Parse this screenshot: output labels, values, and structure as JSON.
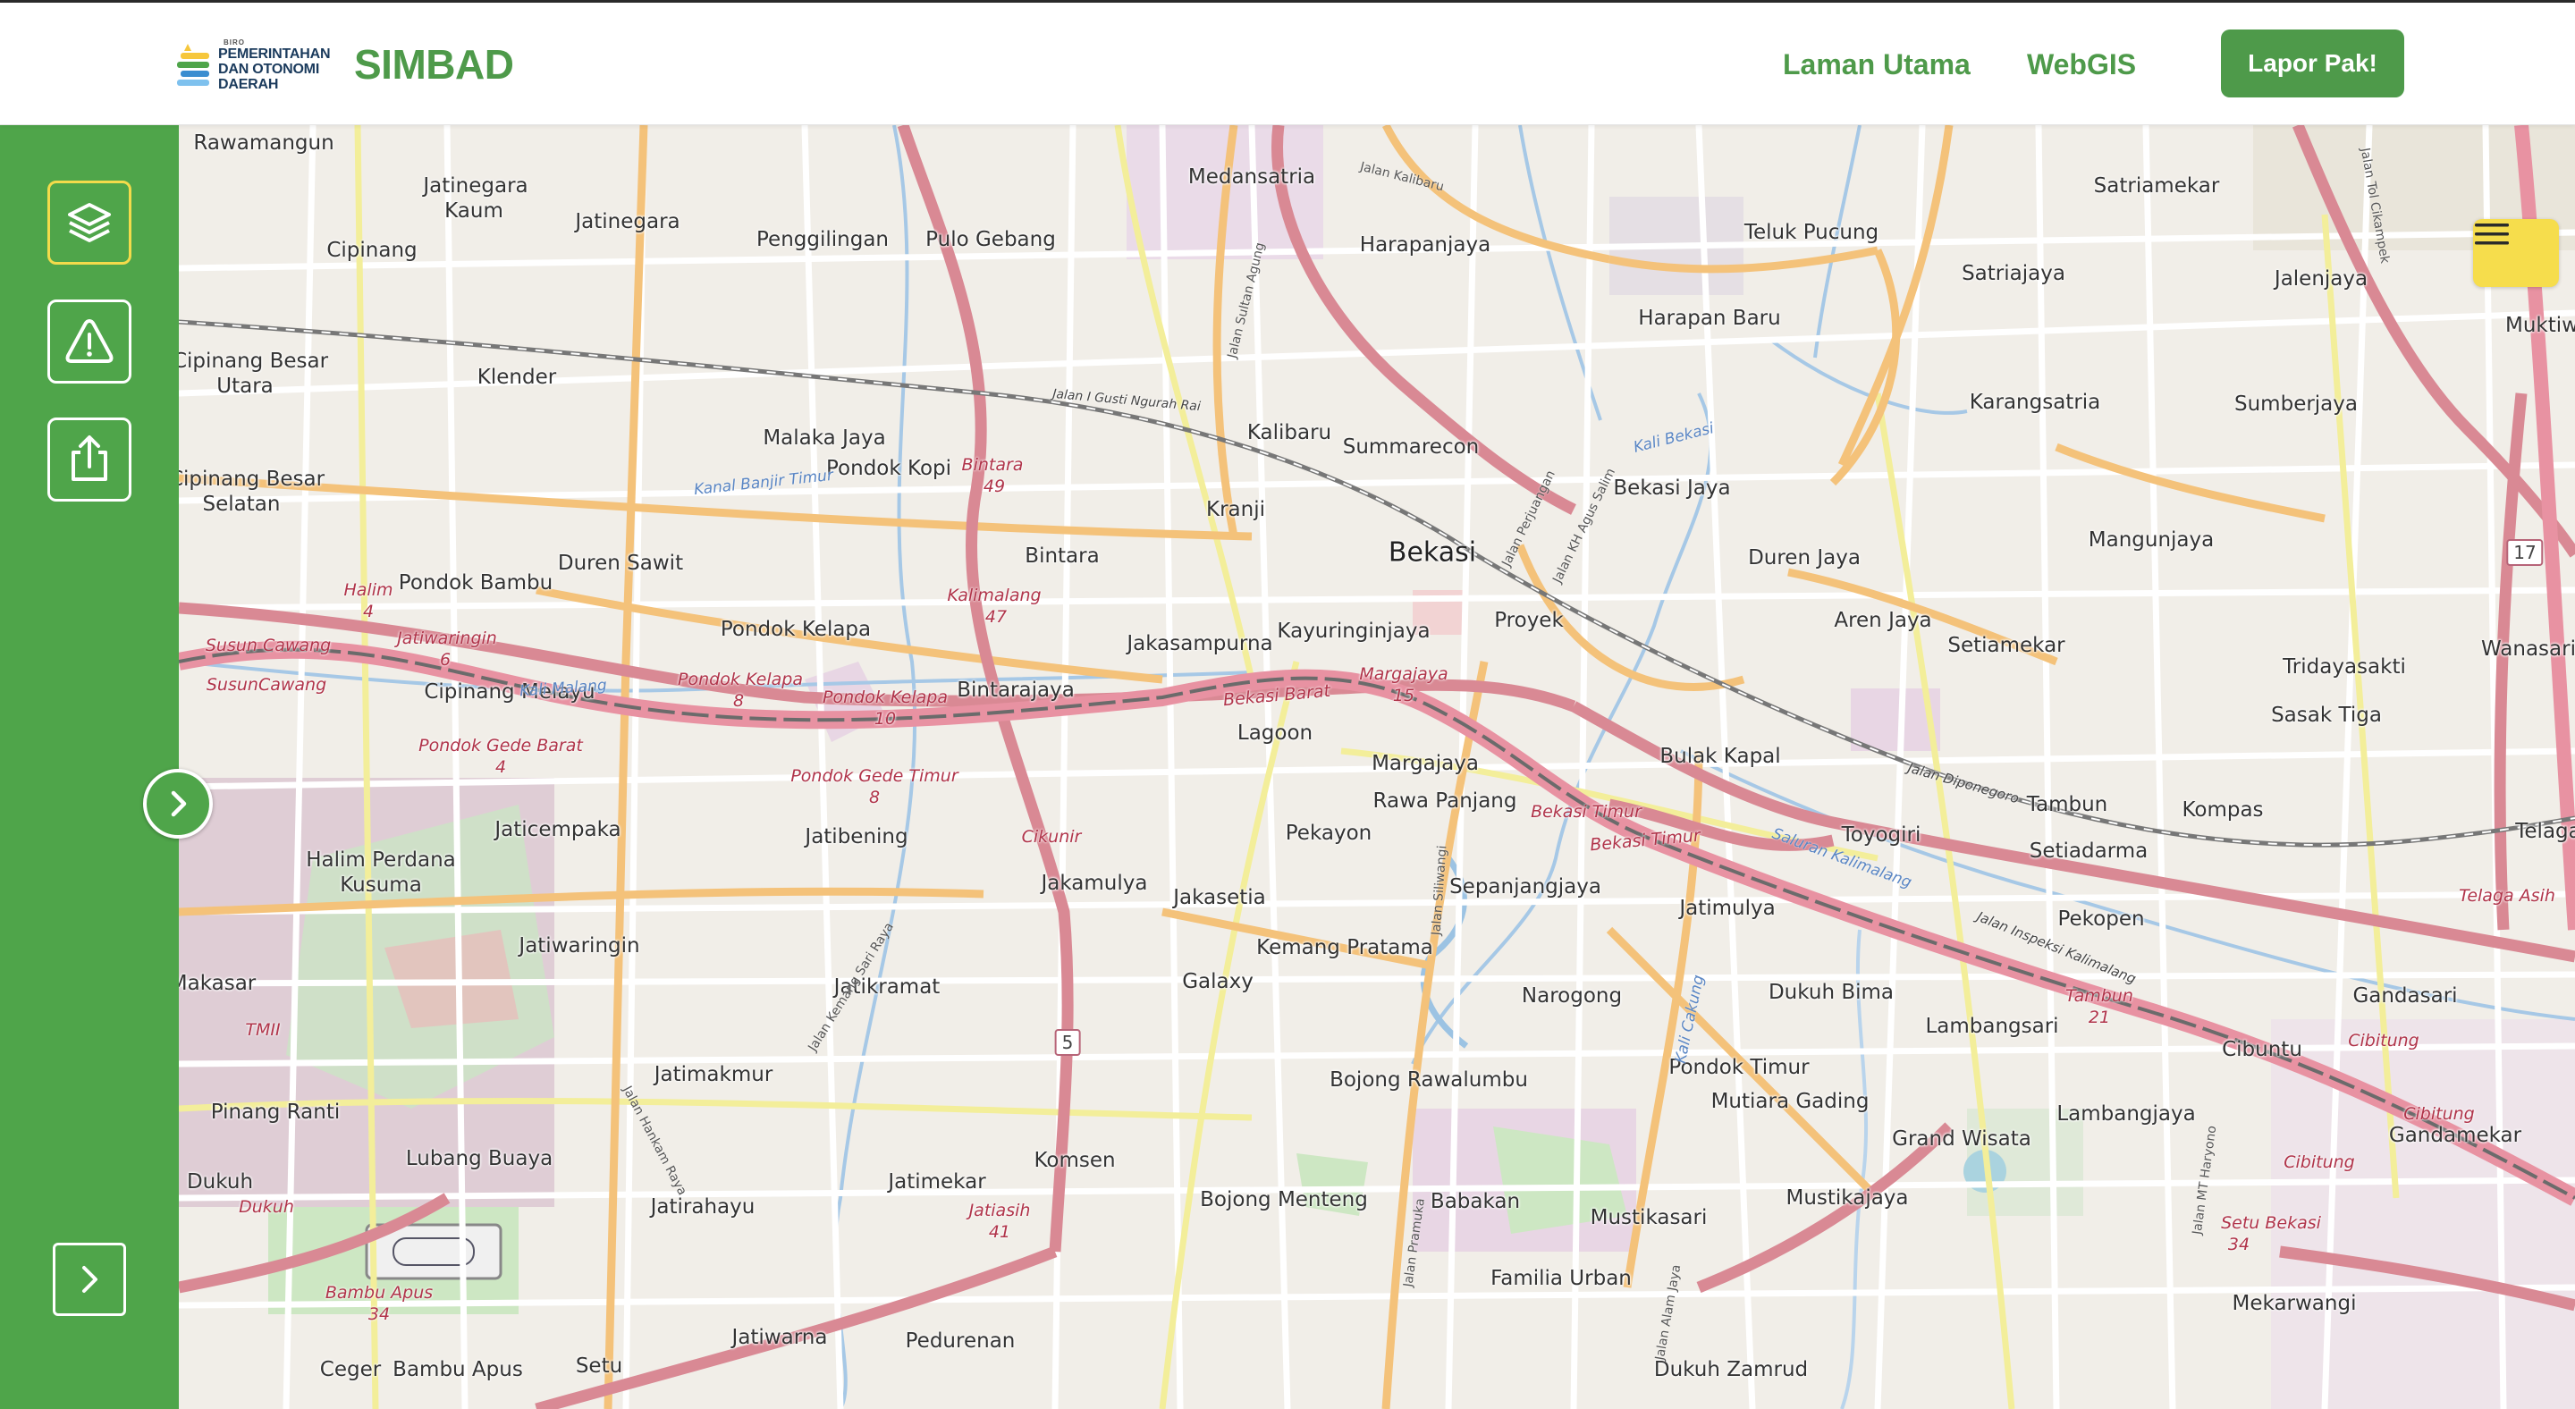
{
  "header": {
    "logo": {
      "small_text": "BIRO",
      "line1": "PEMERINTAHAN",
      "line2": "DAN OTONOMI",
      "line3": "DAERAH"
    },
    "brand": "SIMBAD",
    "nav": [
      "Laman Utama",
      "WebGIS"
    ],
    "report_button": "Lapor Pak!"
  },
  "sidebar": {
    "buttons": [
      {
        "icon": "layers-icon",
        "active": true
      },
      {
        "icon": "warning-icon",
        "active": false
      },
      {
        "icon": "upload-icon",
        "active": false
      }
    ],
    "expand_icon": "chevron-right-icon",
    "toggle_icon": "chevron-right-icon"
  },
  "map": {
    "menu_icon": "hamburger-icon",
    "colors": {
      "accent_green": "#4fa54a",
      "highlight_yellow": "#f6dd4c",
      "primary_road": "#d98994",
      "secondary_road": "#f4c27a"
    },
    "places": [
      "Rawamangun",
      "Jatinegara Kaum",
      "Jatinegara",
      "Cipinang",
      "Penggilingan",
      "Pulo Gebang",
      "Medansatria",
      "Harapanjaya",
      "Teluk Pucung",
      "Satriamekar",
      "Satriajaya",
      "Jalenjaya",
      "Muktiwa",
      "Cipinang Besar Utara",
      "Klender",
      "Malaka Jaya",
      "Kalibaru",
      "Summarecon",
      "Harapan Baru",
      "Karangsatria",
      "Sumberjaya",
      "Cipinang Besar Selatan",
      "Pondok Kopi",
      "Bintara",
      "Kranji",
      "Bekasi Jaya",
      "Mangunjaya",
      "Pondok Bambu",
      "Duren Sawit",
      "Bekasi",
      "Duren Jaya",
      "Wanasari",
      "Pondok Kelapa",
      "Jakasampurna",
      "Kayuringinjaya",
      "Proyek",
      "Aren Jaya",
      "Setiamekar",
      "Tridayasakti",
      "Cipinang Melayu",
      "Bintarajaya",
      "Lagoon",
      "Bulak Kapal",
      "Sasak Tiga",
      "Rawa Panjang",
      "Margajaya",
      "Tambun",
      "Kompas",
      "Telaga",
      "Halim Perdana Kusuma",
      "Jaticempaka",
      "Jatibening",
      "Pekayon",
      "Toyogiri",
      "Setiadarma",
      "Jakamulya",
      "Jakasetia",
      "Sepanjangjaya",
      "Jatimulya",
      "Pekopen",
      "Jatiwaringin",
      "Jatikramat",
      "Kemang Pratama",
      "Galaxy",
      "Narogong",
      "Dukuh Bima",
      "Gandasari",
      "Makasar",
      "Lambangsari",
      "Cibuntu",
      "Jatimakmur",
      "Bojong Rawalumbu",
      "Pondok Timur",
      "Mutiara Gading",
      "Lambangjaya",
      "Gandamekar",
      "Pinang Ranti",
      "Lubang Buaya",
      "Grand Wisata",
      "Dukuh",
      "Jatirahayu",
      "Jatimekar",
      "Komsen",
      "Bojong Menteng",
      "Babakan",
      "Mustikasari",
      "Mustikajaya",
      "Familia Urban",
      "Mekarwangi",
      "Jatiwarna",
      "Pedurenan",
      "Setu",
      "Bambu Apus",
      "Ceger",
      "Dukuh Zamrud"
    ],
    "road_labels": [
      "Jalan I Gusti Ngurah Rai",
      "Bintara 49",
      "Kalimalang 47",
      "Halim 4",
      "Jatiwaringin 6",
      "Pondok Kelapa 8",
      "Pondok Kelapa 10",
      "Bekasi Barat",
      "Margajaya 15",
      "Pondok Gede Barat 4",
      "Pondok Gede Timur 8",
      "Cikunir",
      "Bekasi Timur",
      "Jalan Diponegoro",
      "Jalan Inspeksi Kalimalang",
      "Tambun 21",
      "Telaga Asih",
      "Cibitung",
      "Jatiasih 41",
      "Setu Bekasi 34",
      "Bambu Apus 34",
      "Jalan Kalibaru",
      "Jalan Sultan Agung",
      "Jalan Perjuangan",
      "Jalan KH Agus Salim",
      "Jalan Siliwangi",
      "Jalan Kemang Sari Raya",
      "Jalan Hankam Raya",
      "Jalan Pramuka",
      "Jalan Alam Jaya",
      "Jalan MT Haryono",
      "Jalan Tol Cikampek",
      "Saluran Kalimalang",
      "Kali Bekasi",
      "Kanal Banjir Timur",
      "Kali Cakung",
      "Kali Malang",
      "Susun Cawang"
    ],
    "shields": [
      "5",
      "17"
    ]
  }
}
